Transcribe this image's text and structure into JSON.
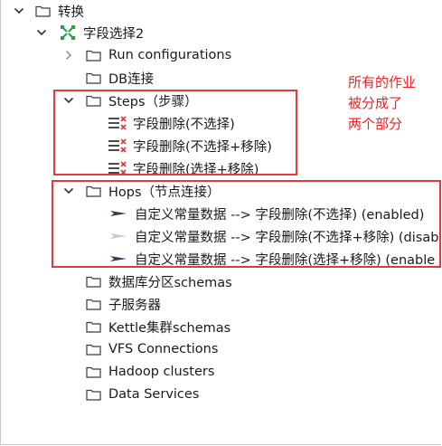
{
  "tree": {
    "root": {
      "label": "转换"
    },
    "transformation": {
      "label": "字段选择2"
    },
    "run_configurations": {
      "label": "Run configurations"
    },
    "db_connections": {
      "label": "DB连接"
    },
    "steps": {
      "label": "Steps（步骤）",
      "items": [
        {
          "label": "字段删除(不选择)"
        },
        {
          "label": "字段删除(不选择+移除)"
        },
        {
          "label": "字段删除(选择+移除)"
        }
      ]
    },
    "hops": {
      "label": "Hops（节点连接）",
      "items": [
        {
          "label": "自定义常量数据 --> 字段删除(不选择) (enabled)",
          "enabled": true
        },
        {
          "label": "自定义常量数据 --> 字段删除(不选择+移除) (disab",
          "enabled": false
        },
        {
          "label": "自定义常量数据 --> 字段删除(选择+移除) (enable",
          "enabled": true
        }
      ]
    },
    "partition_schemas": {
      "label": "数据库分区schemas"
    },
    "slave_servers": {
      "label": "子服务器"
    },
    "cluster_schemas": {
      "label": "Kettle集群schemas"
    },
    "vfs_connections": {
      "label": "VFS Connections"
    },
    "hadoop_clusters": {
      "label": "Hadoop clusters"
    },
    "data_services": {
      "label": "Data Services"
    }
  },
  "annotation": {
    "lines": [
      "所有的作业",
      "被分成了",
      "两个部分"
    ],
    "color": "#e03a3a"
  },
  "colors": {
    "folder_stroke": "#3a3a3a",
    "hop_enabled": "#2d3f52",
    "hop_disabled": "#c8c8c8",
    "trans_icon": "#2e9d4a"
  }
}
